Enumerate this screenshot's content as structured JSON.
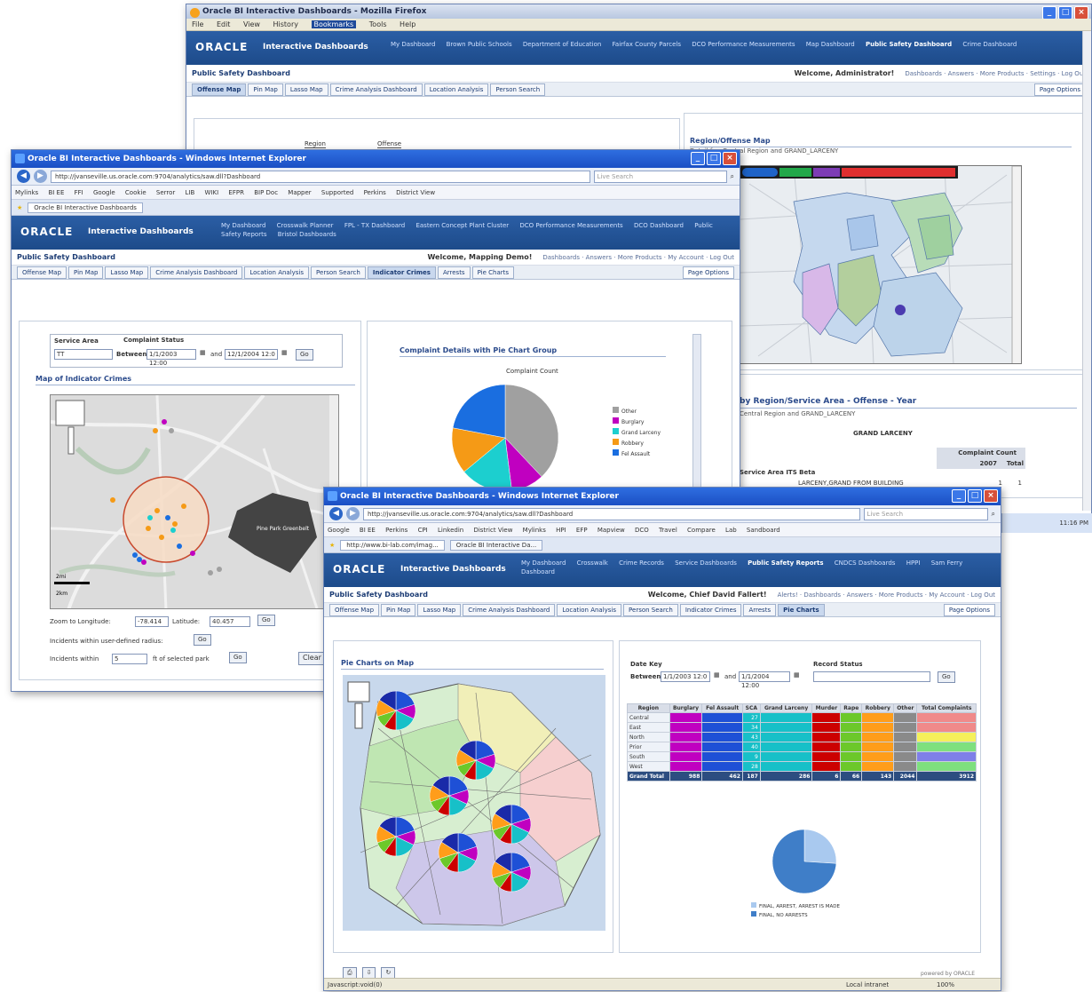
{
  "win1": {
    "title": "Oracle BI Interactive Dashboards - Mozilla Firefox",
    "menu": [
      "File",
      "Edit",
      "View",
      "History",
      "Bookmarks",
      "Tools",
      "Help"
    ],
    "oracle_logo": "ORACLE",
    "product": "Interactive Dashboards",
    "links": [
      "My Dashboard",
      "Brown Public Schools",
      "Department of Education",
      "Fairfax County Parcels",
      "DCO Performance Measurements",
      "Map Dashboard",
      "Public Safety Dashboard",
      "Crime Dashboard"
    ],
    "dash_title": "Public Safety Dashboard",
    "welcome": "Welcome, Administrator!",
    "header_links": "Dashboards · Answers · More Products · Settings · Log Out",
    "tabs": [
      "Offense Map",
      "Pin Map",
      "Lasso Map",
      "Crime Analysis Dashboard",
      "Location Analysis",
      "Person Search"
    ],
    "page_options": "Page Options",
    "prompt_labels": [
      "Region",
      "Offense"
    ],
    "right_panel_title": "Region/Offense Map",
    "right_panel_sub": "Detail for: Central Region and GRAND_LARCENY",
    "table_panel_title": "by Region/Service Area - Offense - Year",
    "table_panel_sub": "Central Region and GRAND_LARCENY",
    "table_col": "GRAND LARCENY",
    "table_col2": "Complaint Count",
    "table_col3": "2007",
    "table_col4": "Total",
    "table_row_label": "Service Area ITS Beta",
    "table_row_value": "LARCENY,GRAND FROM BUILDING",
    "table_v1": "1",
    "table_v2": "1",
    "legend_colors": [
      "#1e63c8",
      "#1e63c8",
      "#22a84a",
      "#7d3cb5",
      "#e02f2f",
      "#e02f2f"
    ],
    "tray_clock": "11:16 PM"
  },
  "win2": {
    "title": "Oracle BI Interactive Dashboards - Windows Internet Explorer",
    "url": "http://jvanseville.us.oracle.com:9704/analytics/saw.dll?Dashboard",
    "search_placeholder": "Live Search",
    "favorites": [
      "Mylinks",
      "BI EE",
      "FFI",
      "Google",
      "Cookie",
      "Serror",
      "LIB",
      "WIKI",
      "EFPR",
      "BIP Doc",
      "Mapper",
      "Supported",
      "Perkins",
      "District View"
    ],
    "tab_label": "Oracle BI Interactive Dashboards",
    "oracle_logo": "ORACLE",
    "product": "Interactive Dashboards",
    "links": [
      "My Dashboard",
      "Crosswalk Planner",
      "FPL - TX Dashboard",
      "Eastern Concept Plant Cluster",
      "DCO Performance Measurements",
      "DCO Dashboard",
      "Public Safety Reports",
      "Bristol Dashboards"
    ],
    "dash_title": "Public Safety Dashboard",
    "welcome": "Welcome, Mapping Demo!",
    "header_links": "Dashboards · Answers · More Products · My Account · Log Out",
    "tabs": [
      "Offense Map",
      "Pin Map",
      "Lasso Map",
      "Crime Analysis Dashboard",
      "Location Analysis",
      "Person Search",
      "Indicator Crimes",
      "Arrests",
      "Pie Charts"
    ],
    "active_tab": 6,
    "page_options": "Page Options",
    "service_area_label": "Service Area",
    "service_area_value": "TT",
    "complaint_status_label": "Complaint Status",
    "between": "Between",
    "date_from": "1/1/2003 12:00",
    "and": "and",
    "date_to": "12/1/2004 12:0",
    "go": "Go",
    "map_title": "Map of Indicator Crimes",
    "zoom_label": "Zoom to Longitude:",
    "longitude": "-78.414",
    "latitude_label": "Latitude:",
    "latitude": "40.457",
    "go2": "Go",
    "radius_text": "Incidents within user-defined radius:",
    "radius_go": "Go",
    "incidents_text": "Incidents within",
    "incidents_value": "5",
    "parks_text": "ft of selected park",
    "go3": "Go",
    "clear": "Clear",
    "scale_label": "2mi",
    "scale_label2": "2km",
    "chart_title": "Complaint Details with Pie Chart Group",
    "chart_subtitle": "Complaint Count",
    "park_label": "Pine Park Greenbelt"
  },
  "win3": {
    "title": "Oracle BI Interactive Dashboards - Windows Internet Explorer",
    "url": "http://jvanseville.us.oracle.com:9704/analytics/saw.dll?Dashboard",
    "search_placeholder": "Live Search",
    "favorites": [
      "Google",
      "BI EE",
      "Perkins",
      "CPI",
      "Linkedin",
      "District View",
      "Mylinks",
      "HPI",
      "EFP",
      "Mapview",
      "DCO",
      "Travel",
      "Compare",
      "Lab",
      "Sandboard"
    ],
    "tab_labels": [
      "http://www.bi-lab.com/imag...",
      "Oracle BI Interactive Da..."
    ],
    "oracle_logo": "ORACLE",
    "product": "Interactive Dashboards",
    "links": [
      "My Dashboard",
      "Crosswalk",
      "Crime Records",
      "Service Dashboards",
      "Public Safety Reports",
      "CNDCS Dashboards",
      "HPPI",
      "Sam Ferry",
      "Dashboard"
    ],
    "dash_title": "Public Safety Dashboard",
    "welcome": "Welcome, Chief David Fallert!",
    "header_links": "Alerts! · Dashboards · Answers · More Products · My Account · Log Out",
    "tabs": [
      "Offense Map",
      "Pin Map",
      "Lasso Map",
      "Crime Analysis Dashboard",
      "Location Analysis",
      "Person Search",
      "Indicator Crimes",
      "Arrests",
      "Pie Charts"
    ],
    "active_tab": 8,
    "page_options": "Page Options",
    "map_title": "Pie Charts on Map",
    "date_key_label": "Date Key",
    "between": "Between",
    "date_from": "1/1/2003 12:0",
    "and": "and",
    "date_to": "1/1/2004 12:00",
    "record_status_label": "Record Status",
    "go": "Go",
    "table_headers": [
      "Region",
      "Burglary",
      "Fel Assault",
      "SCA",
      "Grand Larceny",
      "Murder",
      "Rape",
      "Robbery",
      "Other",
      "Total Complaints"
    ],
    "table_rows": [
      [
        "Central",
        "",
        "",
        "27",
        "",
        "",
        "",
        "",
        "",
        ""
      ],
      [
        "East",
        "",
        "",
        "34",
        "",
        "",
        "",
        "",
        "",
        ""
      ],
      [
        "North",
        "",
        "",
        "43",
        "",
        "",
        "",
        "",
        "",
        ""
      ],
      [
        "Prior",
        "",
        "",
        "40",
        "",
        "",
        "",
        "",
        "",
        ""
      ],
      [
        "South",
        "",
        "",
        "9",
        "",
        "",
        "",
        "",
        "",
        ""
      ],
      [
        "West",
        "",
        "",
        "28",
        "",
        "",
        "",
        "",
        "",
        ""
      ]
    ],
    "grand_total": [
      "Grand Total",
      "988",
      "462",
      "187",
      "286",
      "6",
      "66",
      "143",
      "2044",
      "3912"
    ],
    "legend": [
      "FINAL, ARREST, ARREST IS MADE",
      "FINAL, NO ARRESTS"
    ],
    "powered_by": "powered by ORACLE",
    "status_left": "Javascript:void(0)",
    "status_zone": "Local intranet",
    "status_zoom": "100%"
  },
  "colors": {
    "title_blue": "#1a4fc4",
    "oracle_banner": "#1d4b8a",
    "burglary": "#c000c0",
    "fel_assault": "#1e50d6",
    "grand_larceny": "#17c0c8",
    "murder": "#cc0000",
    "rape": "#6cc82a",
    "robbery": "#ff9d1a",
    "other": "#8a8a8a",
    "pie_gray": "#a0a0a0",
    "pie_magenta": "#c000c0",
    "pie_cyan": "#1ccfcf",
    "pie_orange": "#f59a16",
    "pie_blue": "#1a6ee0"
  },
  "pie_legend2": [
    "Other",
    "Burglary",
    "Grand Larceny",
    "Robbery",
    "Fel Assault"
  ]
}
